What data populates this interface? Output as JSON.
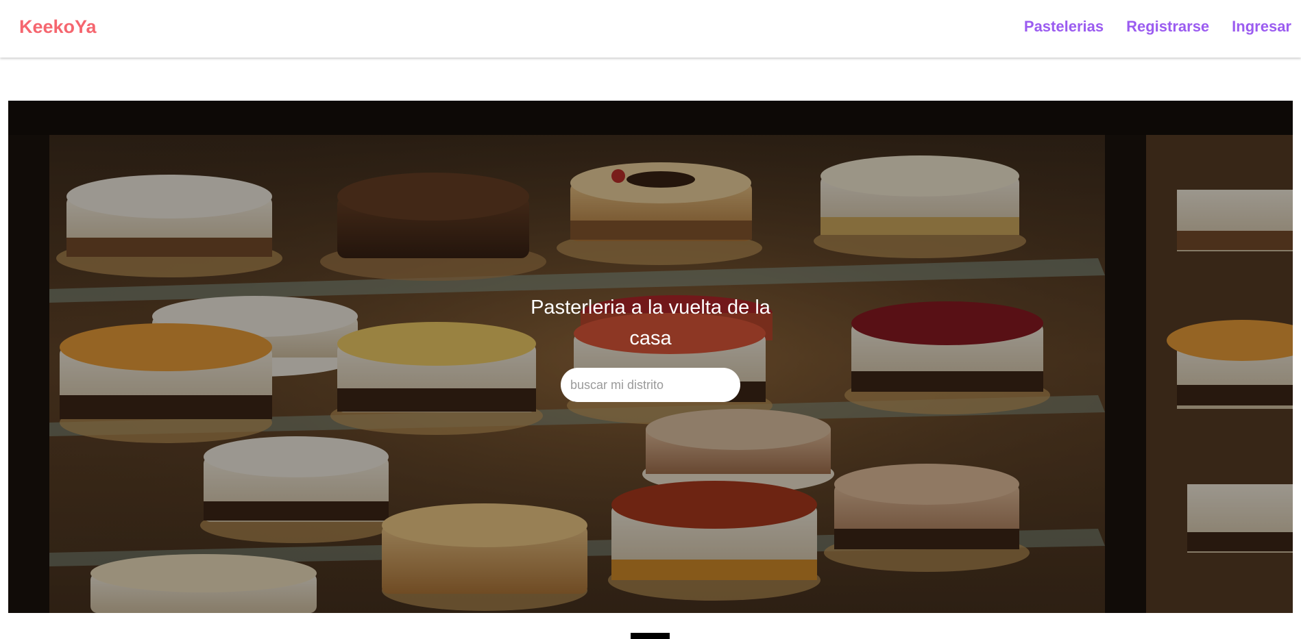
{
  "navbar": {
    "brand": "KeekoYa",
    "links": [
      {
        "label": "Pastelerias"
      },
      {
        "label": "Registrarse"
      },
      {
        "label": "Ingresar"
      }
    ]
  },
  "hero": {
    "title": "Pasterleria a la vuelta de la casa",
    "search": {
      "placeholder": "buscar mi distrito",
      "value": ""
    },
    "image": "bakery-display-case-cakes"
  },
  "colors": {
    "brand": "#f5666f",
    "nav_link": "#9b5cf0",
    "hero_overlay": "#000000"
  }
}
